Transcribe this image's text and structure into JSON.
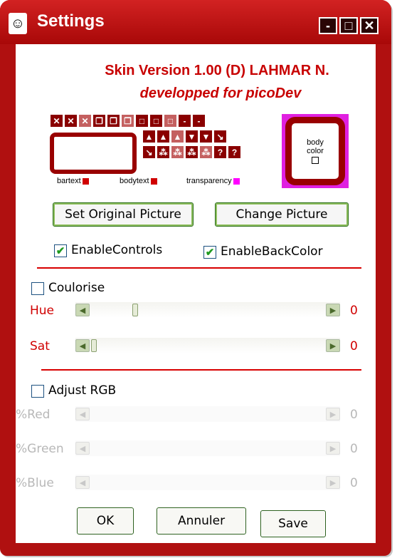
{
  "window": {
    "title": "Settings",
    "minimize_glyph": "-",
    "maximize_glyph": "□",
    "close_glyph": "✕"
  },
  "skin": {
    "version": "Skin Version 1.00 (D)  LAHMAR N.",
    "credit": "developped for picoDev",
    "body_color_label": [
      "body",
      "color"
    ],
    "legend": {
      "bartext": "bartext",
      "bodytext": "bodytext",
      "transparency": "transparency"
    },
    "sprite_glyphs": [
      "✕",
      "✕",
      "✕",
      "❐",
      "❐",
      "❐",
      "□",
      "□",
      "□",
      "-",
      "-",
      "▲",
      "▲",
      "▲",
      "▼",
      "▼",
      "↘",
      "↘",
      "⁂",
      "⁂",
      "⁂",
      "⁂",
      "?",
      "?"
    ]
  },
  "buttons": {
    "set_original": "Set Original Picture",
    "change_picture": "Change Picture",
    "ok": "OK",
    "cancel": "Annuler",
    "save": "Save"
  },
  "checkboxes": {
    "enable_controls": {
      "label": "EnableControls",
      "checked": true
    },
    "enable_back_color": {
      "label": "EnableBackColor",
      "checked": true
    },
    "coulorise": {
      "label": "Coulorise",
      "checked": false
    },
    "adjust_rgb": {
      "label": "Adjust RGB",
      "checked": false
    }
  },
  "sliders": {
    "hue": {
      "label": "Hue",
      "value": "0",
      "position": 0.2
    },
    "sat": {
      "label": "Sat",
      "value": "0",
      "position": 0.0
    },
    "red": {
      "label": "%Red",
      "value": "0"
    },
    "green": {
      "label": "%Green",
      "value": "0"
    },
    "blue": {
      "label": "%Blue",
      "value": "0"
    }
  },
  "colors": {
    "accent": "#c80000",
    "window_frame": "#b01010",
    "label_red": "#d00000",
    "disabled": "#b8b8b8",
    "transparency_swatch": "#ff00ff"
  }
}
